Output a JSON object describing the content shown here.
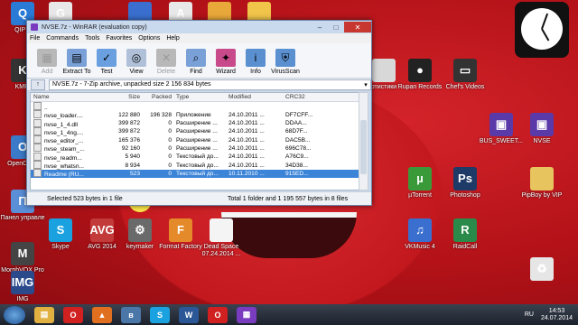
{
  "desktop": {
    "icons": [
      {
        "id": "qip",
        "label": "QIP 2",
        "glyph": "Q",
        "color": "#2a7bd6"
      },
      {
        "id": "google",
        "label": "",
        "glyph": "G",
        "color": "#e8e8e8"
      },
      {
        "id": "icon-top-3",
        "label": "",
        "glyph": "",
        "color": "#3a6fd0"
      },
      {
        "id": "acrobat",
        "label": "",
        "glyph": "A",
        "color": "#e8e8e8"
      },
      {
        "id": "icon-top-5",
        "label": "",
        "glyph": "",
        "color": "#e9a83a"
      },
      {
        "id": "icon-top-6",
        "label": "",
        "glyph": "",
        "color": "#f1c54a"
      },
      {
        "id": "kmp",
        "label": "KMPl",
        "glyph": "K",
        "color": "#333333"
      },
      {
        "id": "opencl",
        "label": "OpenC 4.0",
        "glyph": "O",
        "color": "#3a7ac8"
      },
      {
        "id": "panel",
        "label": "Панел управле",
        "glyph": "П",
        "color": "#5a8fd8"
      },
      {
        "id": "morphvox",
        "label": "MorphVOX Pro",
        "glyph": "M",
        "color": "#444444"
      },
      {
        "id": "img",
        "label": "IMG",
        "glyph": "IMG",
        "color": "#2b4a8c"
      },
      {
        "id": "skype",
        "label": "Skype",
        "glyph": "S",
        "color": "#1aa1e0"
      },
      {
        "id": "avg",
        "label": "AVG 2014",
        "glyph": "AVG",
        "color": "#c23a3a"
      },
      {
        "id": "keymaker",
        "label": "keymaker",
        "glyph": "⚙",
        "color": "#6a6a6a"
      },
      {
        "id": "formatfactory",
        "label": "Format Factory",
        "glyph": "F",
        "color": "#e58a2a"
      },
      {
        "id": "deadspace",
        "label": "Dead Space 07.24.2014 ...",
        "glyph": "",
        "color": "#f4f4f4"
      },
      {
        "id": "artistic",
        "label": "ртистики",
        "glyph": "",
        "color": "#d8d8d8"
      },
      {
        "id": "rupan",
        "label": "Rupan Records",
        "glyph": "●",
        "color": "#222222"
      },
      {
        "id": "chefsvideos",
        "label": "Chef's Videos",
        "glyph": "▭",
        "color": "#333333"
      },
      {
        "id": "bussweet",
        "label": "BUS_SWEET...",
        "glyph": "▣",
        "color": "#5a3aa8"
      },
      {
        "id": "nvse",
        "label": "NVSE",
        "glyph": "▣",
        "color": "#5a3aa8"
      },
      {
        "id": "utorrent",
        "label": "µTorrent",
        "glyph": "µ",
        "color": "#3a9a3a"
      },
      {
        "id": "photoshop",
        "label": "Photoshop",
        "glyph": "Ps",
        "color": "#1e3a66"
      },
      {
        "id": "pipboy",
        "label": "PipBoy by VIP",
        "glyph": "",
        "color": "#e7c45e"
      },
      {
        "id": "vkmusic",
        "label": "VKMusic 4",
        "glyph": "♫",
        "color": "#3a6fd0"
      },
      {
        "id": "raidcall",
        "label": "RaidCall",
        "glyph": "R",
        "color": "#2a8a4a"
      },
      {
        "id": "recyclebin",
        "label": "",
        "glyph": "♻",
        "color": "#e6e6e6"
      }
    ]
  },
  "winrar": {
    "title": "NVSE.7z - WinRAR (evaluation copy)",
    "menu": [
      "File",
      "Commands",
      "Tools",
      "Favorites",
      "Options",
      "Help"
    ],
    "toolbar": [
      {
        "label": "Add",
        "disabled": true,
        "color": "#b8b8b8",
        "glyph": "▦"
      },
      {
        "label": "Extract To",
        "disabled": false,
        "color": "#7aa0d8",
        "glyph": "▤"
      },
      {
        "label": "Test",
        "disabled": false,
        "color": "#6aa0e0",
        "glyph": "✓"
      },
      {
        "label": "View",
        "disabled": false,
        "color": "#b0c0d8",
        "glyph": "◎"
      },
      {
        "label": "Delete",
        "disabled": true,
        "color": "#b8b8b8",
        "glyph": "✕"
      },
      {
        "label": "Find",
        "disabled": false,
        "color": "#7aa0d8",
        "glyph": "⌕"
      },
      {
        "label": "Wizard",
        "disabled": false,
        "color": "#c84a8a",
        "glyph": "✦"
      },
      {
        "label": "Info",
        "disabled": false,
        "color": "#5a90d0",
        "glyph": "i"
      },
      {
        "label": "VirusScan",
        "disabled": false,
        "color": "#5a90d0",
        "glyph": "⛨"
      }
    ],
    "address": "NVSE.7z - 7-Zip archive, unpacked size 2 156 834 bytes",
    "columns": {
      "name": "Name",
      "size": "Size",
      "packed": "Packed",
      "type": "Type",
      "modified": "Modified",
      "crc": "CRC32"
    },
    "files": [
      {
        "name": "..",
        "size": "",
        "packed": "",
        "type": "",
        "modified": "",
        "crc": "",
        "selected": false
      },
      {
        "name": "nvse_loader....",
        "size": "122 880",
        "packed": "196 328",
        "type": "Приложение",
        "modified": "24.10.2011 ...",
        "crc": "DF7CFF...",
        "selected": false
      },
      {
        "name": "nvse_1_4.dll",
        "size": "399 872",
        "packed": "0",
        "type": "Расширение ...",
        "modified": "24.10.2011 ...",
        "crc": "DDAA...",
        "selected": false
      },
      {
        "name": "nvse_1_4ng....",
        "size": "399 872",
        "packed": "0",
        "type": "Расширение ...",
        "modified": "24.10.2011 ...",
        "crc": "68D7F...",
        "selected": false
      },
      {
        "name": "nvse_editor_...",
        "size": "165 376",
        "packed": "0",
        "type": "Расширение ...",
        "modified": "24.10.2011 ...",
        "crc": "DAC5B...",
        "selected": false
      },
      {
        "name": "nvse_steam_...",
        "size": "92 160",
        "packed": "0",
        "type": "Расширение ...",
        "modified": "24.10.2011 ...",
        "crc": "696C78...",
        "selected": false
      },
      {
        "name": "nvse_readm...",
        "size": "5 940",
        "packed": "0",
        "type": "Текстовый до...",
        "modified": "24.10.2011 ...",
        "crc": "A76C9...",
        "selected": false
      },
      {
        "name": "nvse_whatsn...",
        "size": "8 934",
        "packed": "0",
        "type": "Текстовый до...",
        "modified": "24.10.2011 ...",
        "crc": "34D38...",
        "selected": false
      },
      {
        "name": "Readme (RU...",
        "size": "523",
        "packed": "0",
        "type": "Текстовый до...",
        "modified": "10.11.2010 ...",
        "crc": "915ED...",
        "selected": true
      }
    ],
    "status_left": "Selected 523 bytes in 1 file",
    "status_right": "Total 1 folder and 1 195 557 bytes in 8 files"
  },
  "taskbar": {
    "items": [
      {
        "id": "explorer",
        "glyph": "▤",
        "color": "#e0b040"
      },
      {
        "id": "opera",
        "glyph": "O",
        "color": "#d02020"
      },
      {
        "id": "aimp",
        "glyph": "▲",
        "color": "#e07020"
      },
      {
        "id": "vk",
        "glyph": "в",
        "color": "#4a76a8"
      },
      {
        "id": "skype",
        "glyph": "S",
        "color": "#1aa1e0"
      },
      {
        "id": "word",
        "glyph": "W",
        "color": "#2b5797"
      },
      {
        "id": "opera2",
        "glyph": "O",
        "color": "#d02020"
      },
      {
        "id": "winrar",
        "glyph": "▦",
        "color": "#7a3cbf"
      }
    ],
    "lang": "RU",
    "time": "14:53",
    "date": "24.07.2014"
  }
}
